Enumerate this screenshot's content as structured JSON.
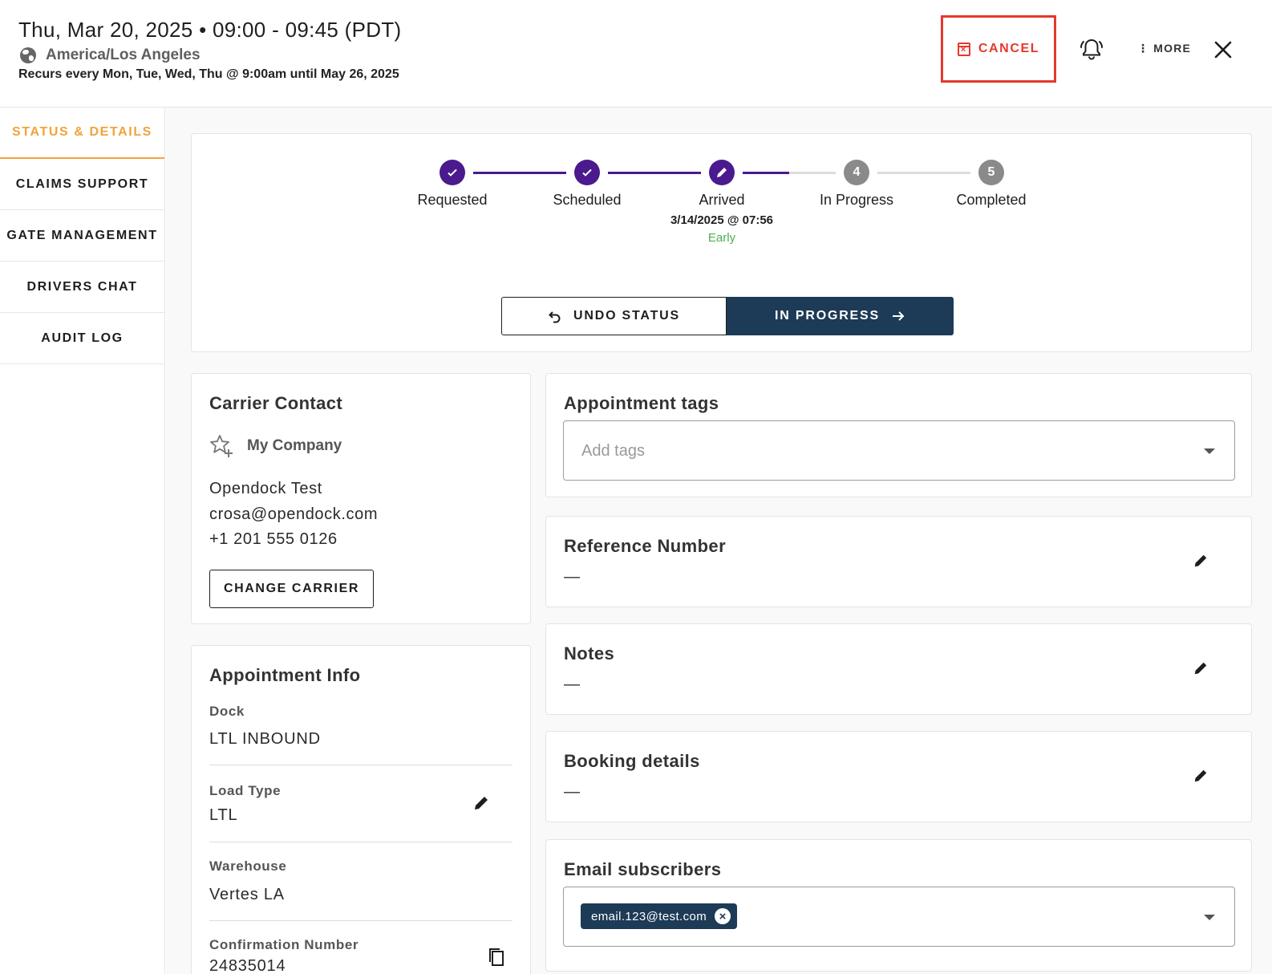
{
  "header": {
    "date_time": "Thu, Mar 20, 2025 • 09:00 - 09:45 (PDT)",
    "timezone": "America/Los Angeles",
    "recurrence": "Recurs every Mon, Tue, Wed, Thu @ 9:00am until May 26, 2025",
    "cancel_label": "CANCEL",
    "more_label": "⋮ MORE",
    "accent_color": "#e6382c"
  },
  "sidebar": {
    "items": [
      {
        "label": "STATUS & DETAILS",
        "active": true
      },
      {
        "label": "CLAIMS SUPPORT",
        "active": false
      },
      {
        "label": "GATE MANAGEMENT",
        "active": false
      },
      {
        "label": "DRIVERS CHAT",
        "active": false
      },
      {
        "label": "AUDIT LOG",
        "active": false
      }
    ],
    "active_color": "#f2a23c"
  },
  "status": {
    "steps": [
      {
        "label": "Requested",
        "state": "done",
        "icon": "check-icon"
      },
      {
        "label": "Scheduled",
        "state": "done",
        "icon": "check-icon"
      },
      {
        "label": "Arrived",
        "state": "done",
        "icon": "pencil-icon",
        "sub": "3/14/2025 @ 07:56",
        "sub2": "Early"
      },
      {
        "label": "In Progress",
        "state": "todo",
        "number": "4"
      },
      {
        "label": "Completed",
        "state": "todo",
        "number": "5"
      }
    ],
    "undo_label": "UNDO STATUS",
    "next_label": "IN PROGRESS",
    "done_color": "#4b1a8e",
    "next_color": "#1d3a57"
  },
  "carrier": {
    "title": "Carrier Contact",
    "company": "My Company",
    "name": "Opendock Test",
    "email": "crosa@opendock.com",
    "phone": "+1 201 555 0126",
    "change_label": "CHANGE CARRIER"
  },
  "appointment_info": {
    "title": "Appointment Info",
    "fields": [
      {
        "label": "Dock",
        "value": "LTL INBOUND"
      },
      {
        "label": "Load Type",
        "value": "LTL"
      },
      {
        "label": "Warehouse",
        "value": "Vertes LA"
      },
      {
        "label": "Confirmation Number",
        "value": "24835014"
      }
    ]
  },
  "tags": {
    "title": "Appointment tags",
    "placeholder": "Add tags"
  },
  "reference": {
    "title": "Reference Number",
    "value": "—"
  },
  "notes": {
    "title": "Notes",
    "value": "—"
  },
  "booking": {
    "title": "Booking details",
    "value": "—"
  },
  "subscribers": {
    "title": "Email subscribers",
    "emails": [
      "email.123@test.com"
    ]
  }
}
